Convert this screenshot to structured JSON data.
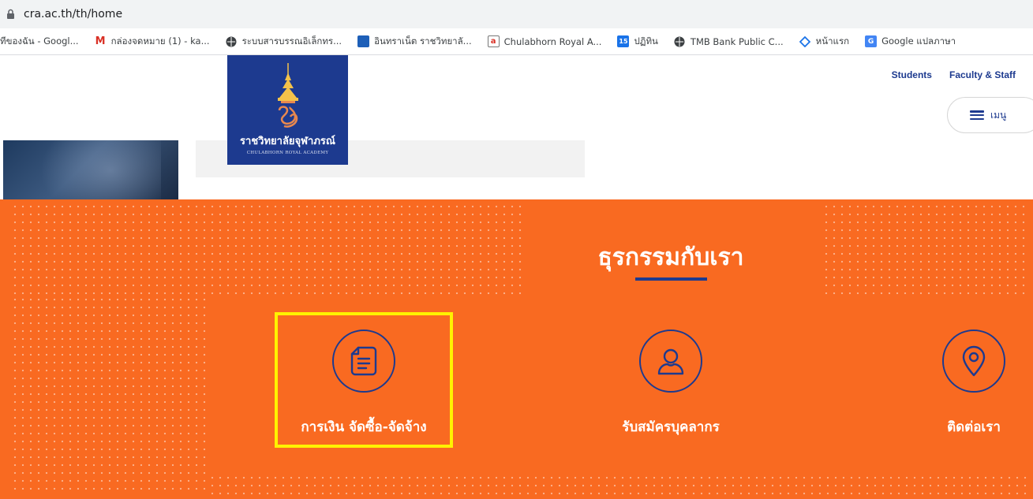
{
  "browser": {
    "url": "cra.ac.th/th/home",
    "bookmarks": [
      {
        "label": "ทีของฉัน - Googl...",
        "icon": "blank-icon"
      },
      {
        "label": "กล่องจดหมาย (1) - ka...",
        "icon": "gmail-icon"
      },
      {
        "label": "ระบบสารบรรณอิเล็กทร...",
        "icon": "globe-icon"
      },
      {
        "label": "อินทราเน็ต ราชวิทยาลั...",
        "icon": "intranet-icon"
      },
      {
        "label": "Chulabhorn Royal A...",
        "icon": "academy-icon"
      },
      {
        "label": "ปฏิทิน",
        "icon": "calendar-icon"
      },
      {
        "label": "TMB Bank Public C...",
        "icon": "globe-icon"
      },
      {
        "label": "หน้าแรก",
        "icon": "drive-icon"
      },
      {
        "label": "Google แปลภาษา",
        "icon": "translate-icon"
      }
    ],
    "calendar_day": "15"
  },
  "header": {
    "logo_th": "ราชวิทยาลัยจุฬาภรณ์",
    "logo_en": "CHULABHORN ROYAL ACADEMY",
    "links": [
      "Students",
      "Faculty & Staff"
    ],
    "menu_label": "เมนู"
  },
  "section": {
    "title": "ธุรกรรมกับเรา",
    "services": [
      {
        "label": "การเงิน จัดซื้อ-จัดจ้าง",
        "icon": "document-icon"
      },
      {
        "label": "รับสมัครบุคลากร",
        "icon": "user-icon"
      },
      {
        "label": "ติดต่อเรา",
        "icon": "location-pin-icon"
      }
    ]
  },
  "colors": {
    "orange": "#f96a21",
    "navy": "#1d3a8f",
    "highlight": "#fff200"
  }
}
